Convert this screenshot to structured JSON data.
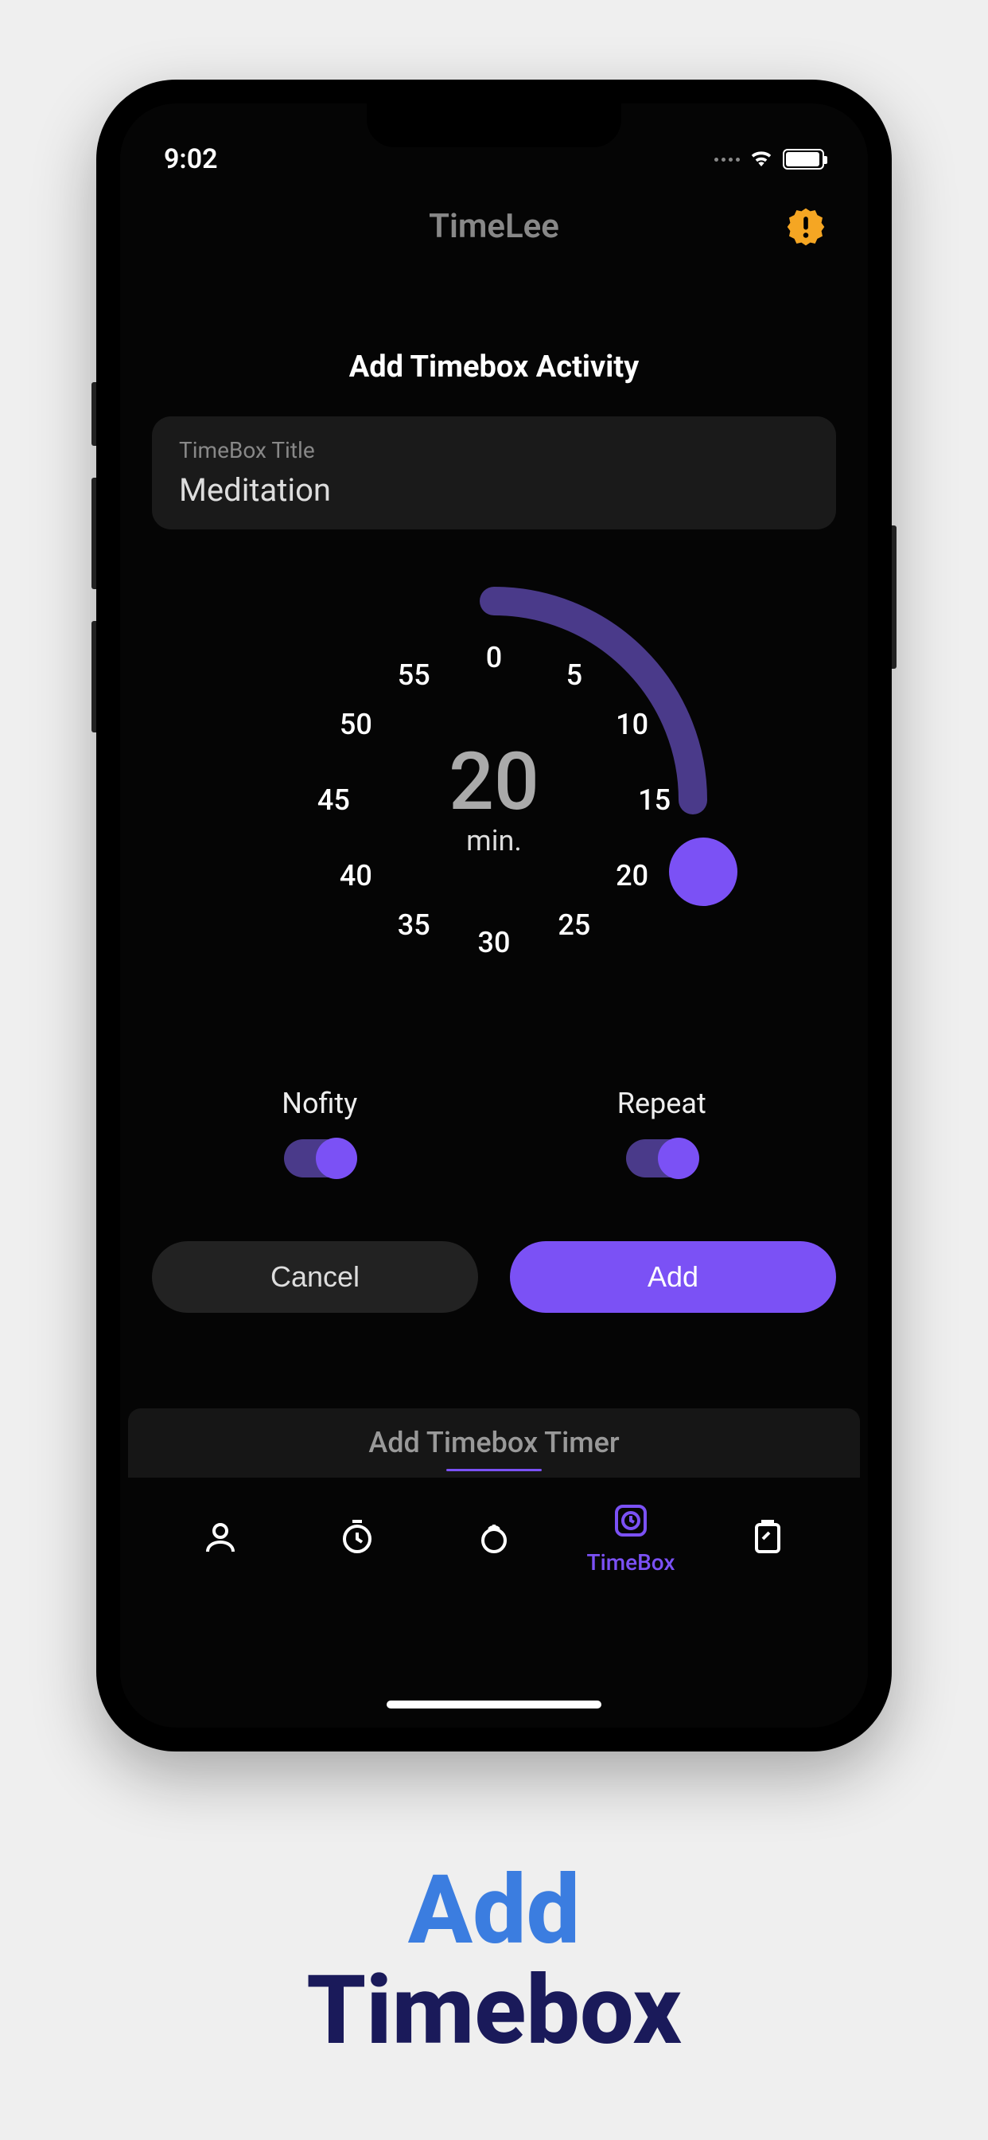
{
  "status": {
    "time": "9:02"
  },
  "header": {
    "title": "TimeLee"
  },
  "form": {
    "section_title": "Add Timebox Activity",
    "title_field": {
      "label": "TimeBox Title",
      "value": "Meditation"
    }
  },
  "dial": {
    "value": "20",
    "unit": "min.",
    "ticks": [
      "0",
      "5",
      "10",
      "15",
      "20",
      "25",
      "30",
      "35",
      "40",
      "45",
      "50",
      "55"
    ]
  },
  "toggles": {
    "notify": {
      "label": "Nofity",
      "on": true
    },
    "repeat": {
      "label": "Repeat",
      "on": true
    }
  },
  "buttons": {
    "cancel": "Cancel",
    "add": "Add"
  },
  "tab_header": "Add Timebox Timer",
  "tabs": {
    "active_label": "TimeBox"
  },
  "promo": {
    "line1": "Add",
    "line2": "Timebox"
  }
}
